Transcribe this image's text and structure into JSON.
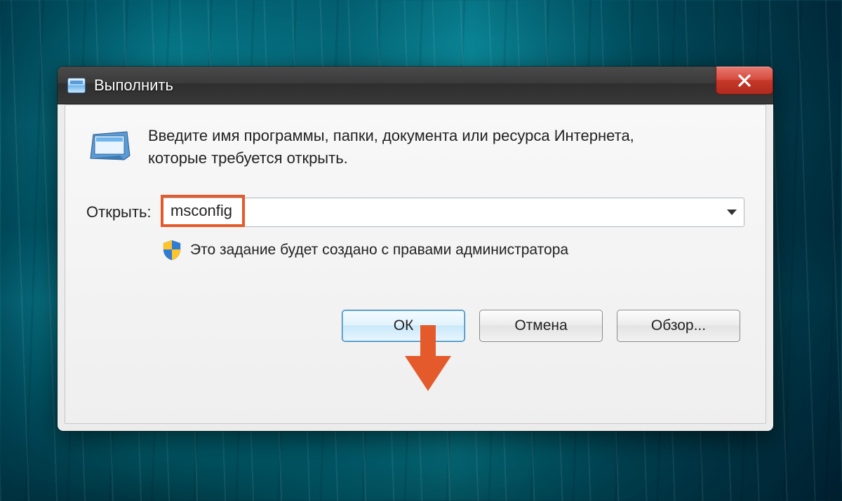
{
  "dialog": {
    "title": "Выполнить",
    "description": "Введите имя программы, папки, документа или ресурса Интернета, которые требуется открыть.",
    "open_label": "Открыть:",
    "command_value": "msconfig",
    "admin_note": "Это задание будет создано с правами администратора",
    "buttons": {
      "ok": "ОК",
      "cancel": "Отмена",
      "browse": "Обзор..."
    }
  },
  "icons": {
    "titlebar": "run-dialog-icon",
    "run": "run-program-icon",
    "shield": "uac-shield-icon",
    "close": "close-icon",
    "dropdown": "chevron-down-icon",
    "arrow": "pointer-arrow-icon"
  }
}
